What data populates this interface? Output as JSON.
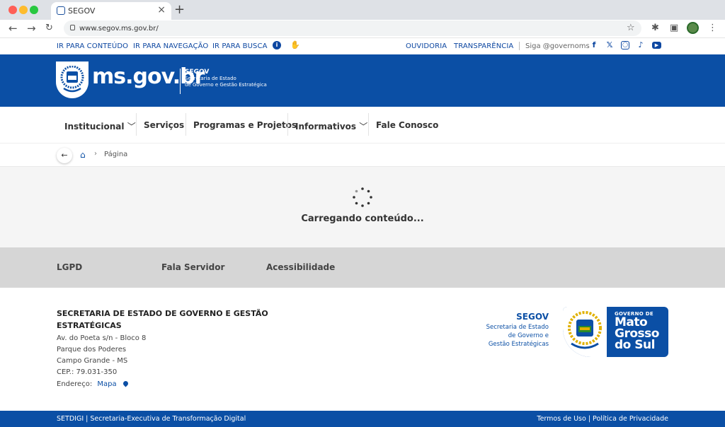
{
  "browser": {
    "tab_title": "SEGOV",
    "url": "www.segov.ms.gov.br/"
  },
  "accessibility_bar": {
    "skip_content": "IR PARA CONTEÚDO",
    "skip_nav": "IR PARA NAVEGAÇÃO",
    "skip_search": "IR PARA BUSCA",
    "ouvidoria": "OUVIDORIA",
    "transparencia": "TRANSPARÊNCIA",
    "follow": "Siga @governoms",
    "social_icons": [
      "facebook-icon",
      "x-icon",
      "instagram-icon",
      "tiktok-icon",
      "youtube-icon"
    ]
  },
  "header": {
    "brand": "ms.gov.br",
    "org_abbr": "SEGOV",
    "org_name_1": "Secretaria de Estado",
    "org_name_2": "de Governo e Gestão Estratégica"
  },
  "nav": {
    "items": [
      "Institucional",
      "Serviços",
      "Programas e Projetos",
      "Informativos",
      "Fale Conosco"
    ]
  },
  "breadcrumb": {
    "page": "Página"
  },
  "loading": {
    "text": "Carregando conteúdo..."
  },
  "footer_links": [
    "LGPD",
    "Fala Servidor",
    "Acessibilidade"
  ],
  "footer": {
    "title": "SECRETARIA DE ESTADO DE GOVERNO E GESTÃO ESTRATÉGICAS",
    "address": [
      "Av. do Poeta s/n - Bloco 8",
      "Parque dos Poderes",
      "Campo Grande - MS",
      "CEP.: 79.031-350"
    ],
    "map_label": "Endereço:",
    "map_link": "Mapa",
    "segov_abbr": "SEGOV",
    "segov_lines": [
      "Secretaria de Estado",
      "de Governo e",
      "Gestão Estratégicas"
    ],
    "gov_label": "GOVERNO DE",
    "gov_lines": [
      "Mato",
      "Grosso",
      "do Sul"
    ]
  },
  "bottom_bar": {
    "left": "SETDIGI | Secretaria-Executiva de Transformação Digital",
    "right": "Termos de Uso | Política de Privacidade"
  },
  "colors": {
    "brand_blue": "#0b4fa5",
    "link_gray": "#d6d6d6"
  }
}
